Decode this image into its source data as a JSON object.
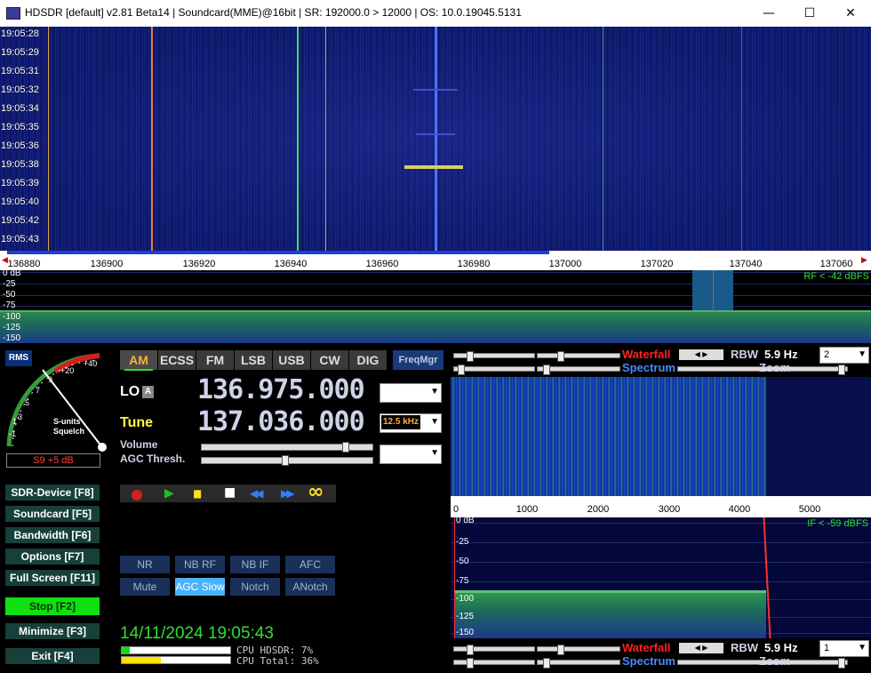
{
  "window": {
    "title": "HDSDR  [default]  v2.81 Beta14  |  Soundcard(MME)@16bit  |  SR: 192000.0 > 12000  |  OS: 10.0.19045.5131",
    "minimize_glyph": "—",
    "maximize_glyph": "☐",
    "close_glyph": "✕"
  },
  "waterfall": {
    "timestamps": [
      "19:05:28",
      "19:05:29",
      "19:05:31",
      "19:05:32",
      "19:05:34",
      "19:05:35",
      "19:05:36",
      "19:05:38",
      "19:05:39",
      "19:05:40",
      "19:05:42",
      "19:05:43"
    ]
  },
  "freq_axis": {
    "labels": [
      "136880",
      "136900",
      "136920",
      "136940",
      "136960",
      "136980",
      "137000",
      "137020",
      "137040",
      "137060"
    ]
  },
  "main_spectrum": {
    "db_labels": [
      "0 dB",
      "-25",
      "-50",
      "-75",
      "-100",
      "-125",
      "-150"
    ],
    "rf_level": "RF < -42 dBFS"
  },
  "smeter": {
    "rms_label": "RMS",
    "scale": [
      "-1",
      "1",
      "3",
      "5",
      "7",
      "9",
      "+20",
      "+40"
    ],
    "caption_line1": "S-units",
    "caption_line2": "Squelch",
    "reading": "S9 +5 dB"
  },
  "modes": [
    "AM",
    "ECSS",
    "FM",
    "LSB",
    "USB",
    "CW",
    "DIG"
  ],
  "freqmgr_label": "FreqMgr",
  "lo": {
    "label": "LO",
    "a_label": "A",
    "value": "136.975.000"
  },
  "tune": {
    "label": "Tune",
    "value": "137.036.000",
    "step": "12.5 kHz"
  },
  "volume_label": "Volume",
  "agc_label": "AGC Thresh.",
  "nav_buttons": [
    {
      "label": "SDR-Device [F8]"
    },
    {
      "label": "Soundcard  [F5]"
    },
    {
      "label": "Bandwidth  [F6]"
    },
    {
      "label": "Options  [F7]"
    },
    {
      "label": "Full Screen  [F11]"
    },
    {
      "label": "Stop  [F2]"
    },
    {
      "label": "Minimize  [F3]"
    },
    {
      "label": "Exit  [F4]"
    }
  ],
  "transport": {
    "record": "●",
    "play": "▶",
    "pause": "▮▮",
    "stop": "■",
    "rewind": "◀◀",
    "forward": "▶▶",
    "loop": "∞"
  },
  "dsp_buttons": [
    "NR",
    "NB RF",
    "NB IF",
    "AFC",
    "Mute",
    "AGC Slow",
    "Notch",
    "ANotch"
  ],
  "clock": "14/11/2024 19:05:43",
  "cpu": {
    "hdsdr_label": "CPU HDSDR:",
    "hdsdr_value": "7%",
    "total_label": "CPU Total:",
    "total_value": "36%",
    "hdsdr_fraction": 0.07,
    "total_fraction": 0.36
  },
  "rf_panel": {
    "waterfall_label": "Waterfall",
    "spectrum_label": "Spectrum",
    "rbw_label": "RBW",
    "rbw_value": "5.9 Hz",
    "zoom_label": "Zoom",
    "zoom_value": "2"
  },
  "if_panel": {
    "axis_labels": [
      "0",
      "1000",
      "2000",
      "3000",
      "4000",
      "5000"
    ],
    "db_labels": [
      "0 dB",
      "-25",
      "-50",
      "-75",
      "-100",
      "-125",
      "-150"
    ],
    "if_level": "IF < -59 dBFS",
    "waterfall_label": "Waterfall",
    "spectrum_label": "Spectrum",
    "rbw_label": "RBW",
    "rbw_value": "5.9 Hz",
    "zoom_label": "Zoom",
    "zoom_value": "1"
  },
  "colors": {
    "accent_red": "#ff2020",
    "stop_green": "#10e010",
    "freq_text": "#cfd2e8",
    "tune_yellow": "#ffff40"
  }
}
